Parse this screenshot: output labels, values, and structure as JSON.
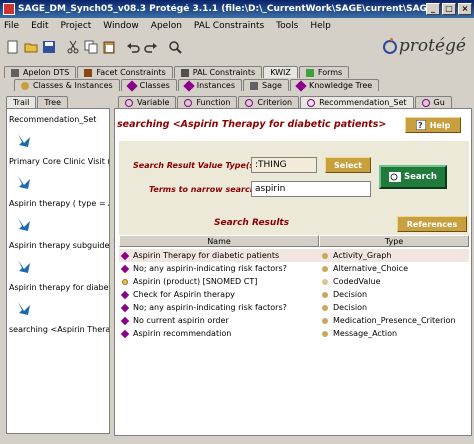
{
  "window": {
    "title": "SAGE_DM_Synch05_v08.3  Protégé 3.1.1    (file:\\D:\\_CurrentWork\\SAGE\\current\\SAGE_DM_Synch05..."
  },
  "menu": [
    "File",
    "Edit",
    "Project",
    "Window",
    "Apelon",
    "PAL Constraints",
    "Tools",
    "Help"
  ],
  "logo": {
    "text": "protégé"
  },
  "tabs_row1": [
    "Apelon DTS",
    "Facet Constraints",
    "PAL Constraints",
    "KWIZ",
    "Forms"
  ],
  "tabs_row2": [
    "Classes & Instances",
    "Classes",
    "Instances",
    "Sage",
    "Knowledge Tree"
  ],
  "left_tabs": [
    "Trail",
    "Tree"
  ],
  "inner_tabs": [
    "Variable",
    "Function",
    "Criterion",
    "Recommendation_Set",
    "Gu"
  ],
  "trail": [
    "Recommendation_Set",
    "Primary Core Clinic Visit ( type",
    "Aspirin therapy ( type = Actio",
    "Aspirin therapy subguideline",
    "Aspirin therapy for diabetic p",
    "searching <Aspirin Therapy"
  ],
  "main": {
    "heading": "searching <Aspirin Therapy for diabetic patients>",
    "help_label": "Help",
    "value_type_label": "Search Result Value Type(s)",
    "value_type": ":THING",
    "select_label": "Select",
    "narrow_label": "Terms to narrow search",
    "narrow_value": "aspirin",
    "search_label": "Search",
    "results_title": "Search Results",
    "references_label": "References",
    "columns": [
      "Name",
      "Type"
    ],
    "results": [
      {
        "name": "Aspirin Therapy for diabetic patients",
        "type": "Activity_Graph",
        "name_icon": "diamond",
        "type_color": "#c8a85a"
      },
      {
        "name": "No; any aspirin-indicating risk factors?",
        "type": "Alternative_Choice",
        "name_icon": "diamond",
        "type_color": "#c8a85a"
      },
      {
        "name": "Aspirin (product) [SNOMED CT]",
        "type": "CodedValue",
        "name_icon": "circle",
        "type_color": "#d8c890"
      },
      {
        "name": "Check for Aspirin therapy",
        "type": "Decision",
        "name_icon": "diamond",
        "type_color": "#c8a85a"
      },
      {
        "name": "No; any aspirin-indicating risk factors?",
        "type": "Decision",
        "name_icon": "diamond",
        "type_color": "#c8a85a"
      },
      {
        "name": "No current aspirin order",
        "type": "Medication_Presence_Criterion",
        "name_icon": "diamond",
        "type_color": "#c8a85a"
      },
      {
        "name": "Aspirin recommendation",
        "type": "Message_Action",
        "name_icon": "diamond",
        "type_color": "#c8a85a"
      }
    ]
  }
}
